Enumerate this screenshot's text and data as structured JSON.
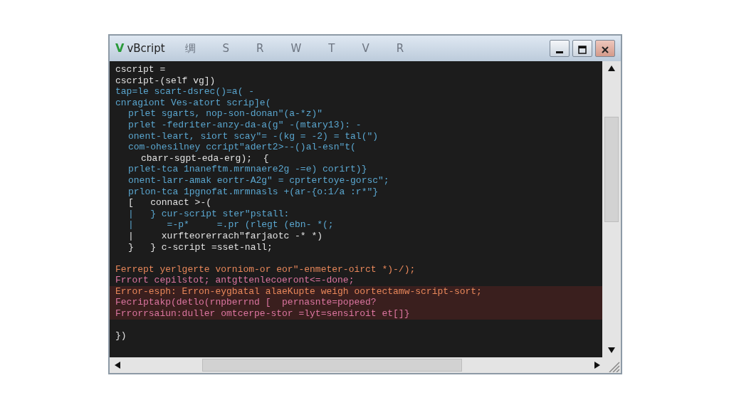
{
  "window": {
    "logo": "V",
    "title": "vBcript",
    "menu": [
      "绸",
      "S",
      "R",
      "W",
      "T",
      "V",
      "R"
    ]
  },
  "editor": {
    "lines": [
      {
        "kind": "plain",
        "text": "cscript ="
      },
      {
        "kind": "plain",
        "text": "cscript-(self vg])"
      },
      {
        "kind": "code",
        "text": "tap=le scart-dsrec()=a( -"
      },
      {
        "kind": "code",
        "text": "cnragiont Ves-atort scrip]e(",
        "children": [
          {
            "kind": "code",
            "text": "prlet sgarts, nop-son-donan\"(a-*z)\""
          },
          {
            "kind": "code",
            "text": "prlet -fedriter-anzy-da-a(g\" -(mtary13): -"
          },
          {
            "kind": "code",
            "text": "onent-leart, siort scay\"= -(kg = -2) = tal(\")"
          },
          {
            "kind": "code",
            "text": "com-ohesilney ccript\"adert2>--()al-esn\"t(",
            "children": [
              {
                "kind": "plain",
                "text": "cbarr-sgpt-eda-erg);  {"
              }
            ]
          },
          {
            "kind": "code",
            "text": "prlet-tca 1naneftm.mrmnaere2g -=e) corirt)}"
          },
          {
            "kind": "code",
            "text": "onent-larr-amak eortr-A2g\" = cprtertoye-gorsc\";"
          },
          {
            "kind": "code",
            "text": "prlon-tca 1pgnofat.mrmnasls +(ar-{o:1/a :r*\"}"
          },
          {
            "kind": "plain",
            "text": "[   connact >-("
          },
          {
            "kind": "code",
            "text": "|   } cur-script ster\"pstall:"
          },
          {
            "kind": "code",
            "text": "|      =-p*     =.pr (rlegt (ebn- *(;"
          },
          {
            "kind": "plain",
            "text": "|     xurfteorerrach\"farjaotc -* *)"
          },
          {
            "kind": "plain",
            "text": "}   } c-script =sset-nall;"
          }
        ]
      },
      {
        "kind": "blank"
      },
      {
        "kind": "error",
        "text": "Ferrept yerlgerte vorniom-or eor\"-enmeter-oirct *)-/);"
      },
      {
        "kind": "fault",
        "text": "Frrort cepilstot; antgttenlecoeront<=-done;"
      },
      {
        "kind": "error",
        "highlighted": true,
        "text": "Error-esph: Erron-eygbatal alaeKupte weigh oortectamw-script-sort;"
      },
      {
        "kind": "fault",
        "highlighted": true,
        "text": "Fecriptakp(detlo(rnpberrnd [  pernasnte=popeed?"
      },
      {
        "kind": "fault",
        "highlighted": true,
        "text": "Frrorrsaiun:duller omtcerpe-stor =lyt=sensiroit et[]}"
      },
      {
        "kind": "blank"
      },
      {
        "kind": "plain",
        "text": "})"
      }
    ]
  }
}
